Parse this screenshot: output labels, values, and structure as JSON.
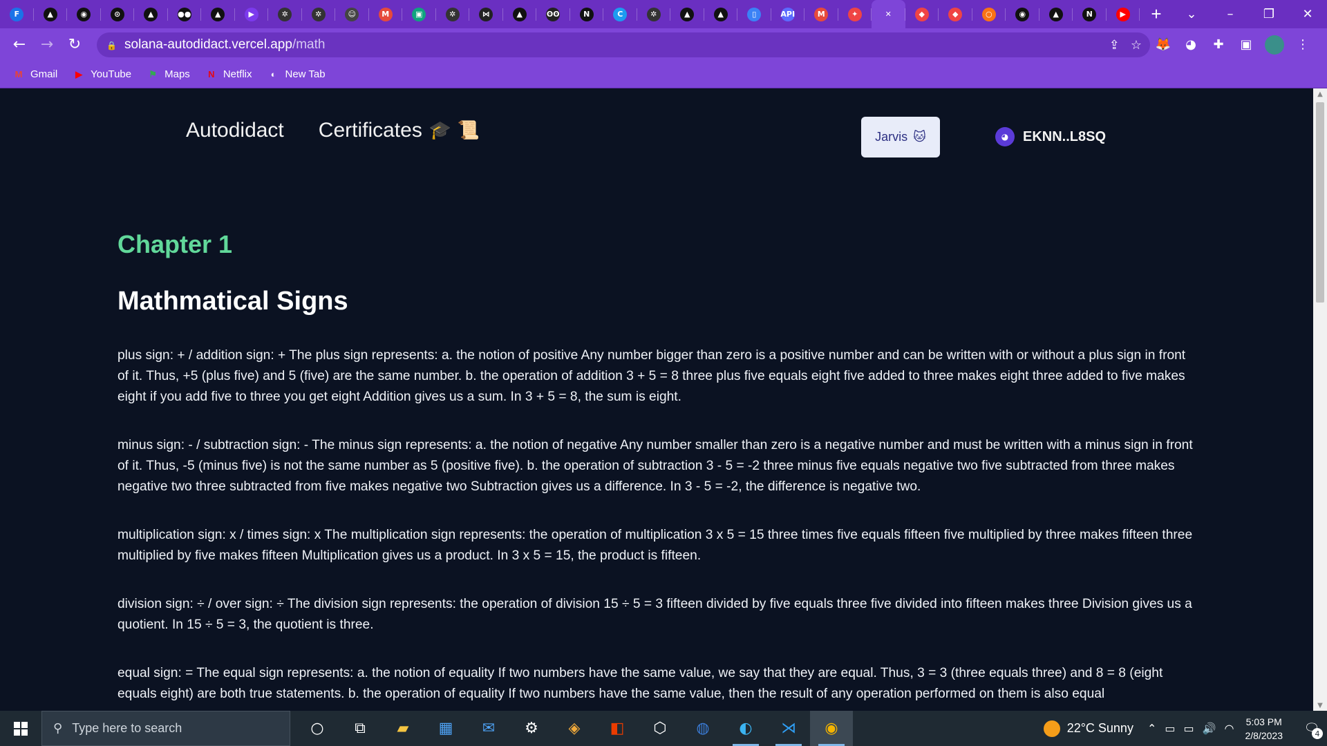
{
  "browser": {
    "tabs": [
      {
        "icon": "F",
        "color": "#1b73e8"
      },
      {
        "icon": "▲",
        "color": "#111111"
      },
      {
        "icon": "◉",
        "color": "#111111"
      },
      {
        "icon": "⊙",
        "color": "#111111"
      },
      {
        "icon": "▲",
        "color": "#111111"
      },
      {
        "icon": "●●",
        "color": "#111111"
      },
      {
        "icon": "▲",
        "color": "#111111"
      },
      {
        "icon": "▶",
        "color": "#7c3aed"
      },
      {
        "icon": "✲",
        "color": "#333333"
      },
      {
        "icon": "✲",
        "color": "#333333"
      },
      {
        "icon": "☺",
        "color": "#444444"
      },
      {
        "icon": "M",
        "color": "#e64a3b"
      },
      {
        "icon": "▣",
        "color": "#10a37f"
      },
      {
        "icon": "✲",
        "color": "#333333"
      },
      {
        "icon": "⋈",
        "color": "#222222"
      },
      {
        "icon": "▲",
        "color": "#111111"
      },
      {
        "icon": "ʘʘ",
        "color": "#222222"
      },
      {
        "icon": "N",
        "color": "#111111"
      },
      {
        "icon": "C",
        "color": "#1d9bf0"
      },
      {
        "icon": "✲",
        "color": "#333333"
      },
      {
        "icon": "▲",
        "color": "#111111"
      },
      {
        "icon": "▲",
        "color": "#111111"
      },
      {
        "icon": "▯",
        "color": "#3b82f6"
      },
      {
        "icon": "API",
        "color": "#5b6cff"
      },
      {
        "icon": "M",
        "color": "#e64a3b"
      },
      {
        "icon": "✦",
        "color": "#ef4444"
      },
      {
        "icon": "✕",
        "color": "#7e45d8"
      },
      {
        "icon": "◆",
        "color": "#ef4444"
      },
      {
        "icon": "◆",
        "color": "#ef4444"
      },
      {
        "icon": "○",
        "color": "#f97316"
      },
      {
        "icon": "◉",
        "color": "#111111"
      },
      {
        "icon": "▲",
        "color": "#111111"
      },
      {
        "icon": "N",
        "color": "#111111"
      },
      {
        "icon": "▶",
        "color": "#ff0000"
      }
    ],
    "active_tab_index": 26,
    "url_host": "solana-autodidact.vercel.app",
    "url_path": "/math",
    "bookmarks": [
      {
        "label": "Gmail",
        "icon": "M",
        "color": "#ea4335"
      },
      {
        "label": "YouTube",
        "icon": "▶",
        "color": "#ff0000"
      },
      {
        "label": "Maps",
        "icon": "⚑",
        "color": "#34a853"
      },
      {
        "label": "Netflix",
        "icon": "N",
        "color": "#e50914"
      },
      {
        "label": "New Tab",
        "icon": "◐",
        "color": "#ffffff"
      }
    ]
  },
  "site": {
    "brand": "Autodidact",
    "certificates_label": "Certificates",
    "certificates_emoji": "🎓 📜",
    "jarvis_label": "Jarvis",
    "jarvis_emoji": "🐱",
    "wallet_address": "EKNN..L8SQ"
  },
  "content": {
    "chapter": "Chapter 1",
    "title": "Mathmatical Signs",
    "paragraphs": [
      "plus sign: + / addition sign: + The plus sign represents: a. the notion of positive Any number bigger than zero is a positive number and can be written with or without a plus sign in front of it. Thus, +5 (plus five) and 5 (five) are the same number. b. the operation of addition 3 + 5 = 8 three plus five equals eight five added to three makes eight three added to five makes eight if you add five to three you get eight Addition gives us a sum. In 3 + 5 = 8, the sum is eight.",
      "minus sign: - / subtraction sign: - The minus sign represents: a. the notion of negative Any number smaller than zero is a negative number and must be written with a minus sign in front of it. Thus, -5 (minus five) is not the same number as 5 (positive five). b. the operation of subtraction 3 - 5 = -2 three minus five equals negative two five subtracted from three makes negative two three subtracted from five makes negative two Subtraction gives us a difference. In 3 - 5 = -2, the difference is negative two.",
      "multiplication sign: x / times sign: x The multiplication sign represents: the operation of multiplication 3 x 5 = 15 three times five equals fifteen five multiplied by three makes fifteen three multiplied by five makes fifteen Multiplication gives us a product. In 3 x 5 = 15, the product is fifteen.",
      "division sign: ÷ / over sign: ÷ The division sign represents: the operation of division 15 ÷ 5 = 3 fifteen divided by five equals three five divided into fifteen makes three Division gives us a quotient. In 15 ÷ 5 = 3, the quotient is three.",
      "equal sign: = The equal sign represents: a. the notion of equality If two numbers have the same value, we say that they are equal. Thus, 3 = 3 (three equals three) and 8 = 8 (eight equals eight) are both true statements. b. the operation of equality If two numbers have the same value, then the result of any operation performed on them is also equal"
    ]
  },
  "taskbar": {
    "search_placeholder": "Type here to search",
    "weather": "22°C  Sunny",
    "time": "5:03 PM",
    "date": "2/8/2023",
    "notification_count": "4"
  }
}
